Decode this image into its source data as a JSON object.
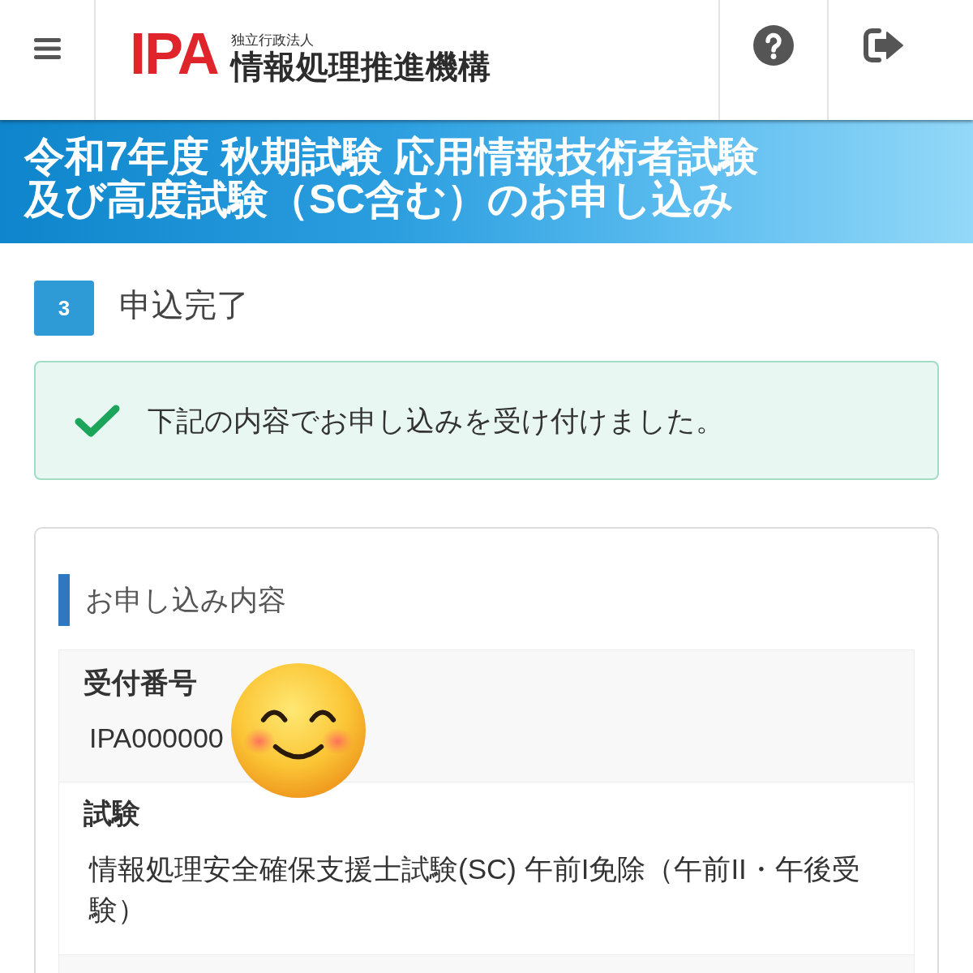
{
  "header": {
    "logo": {
      "mark": "IPA",
      "org_type": "独立行政法人",
      "org_name": "情報処理推進機構"
    }
  },
  "banner": {
    "title": "令和7年度 秋期試験 応用情報技術者試験及び高度試験（SC含む）のお申し込み"
  },
  "step": {
    "number": "3",
    "title": "申込完了"
  },
  "alert": {
    "kind": "success",
    "message": "下記の内容でお申し込みを受け付けました。"
  },
  "details": {
    "heading": "お申し込み内容",
    "items": [
      {
        "label": "受付番号",
        "value": "IPA000000"
      },
      {
        "label": "試験",
        "value": "情報処理安全確保支援士試験(SC) 午前I免除（午前II・午後受験）"
      }
    ]
  }
}
